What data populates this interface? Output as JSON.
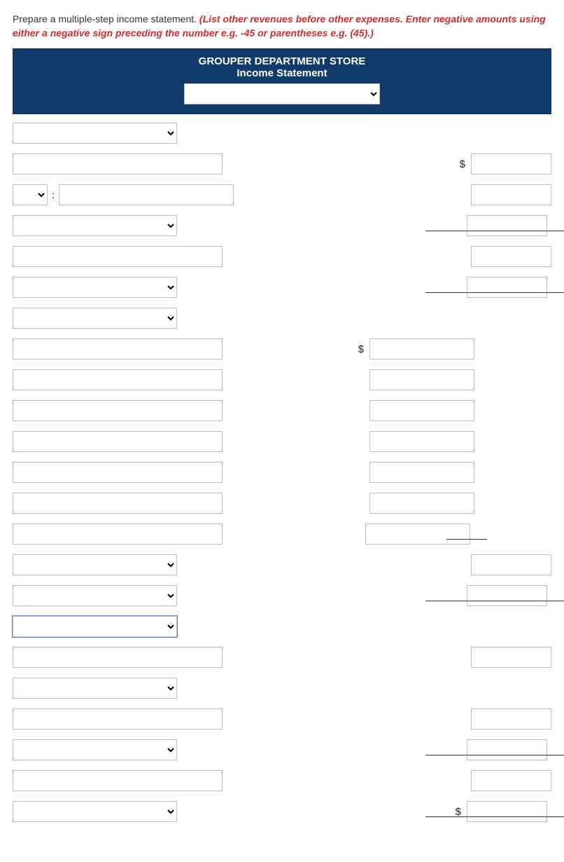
{
  "instructions": {
    "lead": "Prepare a multiple-step income statement. ",
    "em": "(List other revenues before other expenses. Enter negative amounts using either a negative sign preceding the number e.g. -45 or parentheses e.g. (45).)"
  },
  "header": {
    "company": "GROUPER DEPARTMENT STORE",
    "statement": "Income Statement",
    "period_select": ""
  },
  "rows": [
    {
      "left_type": "select-sm",
      "left_val": "",
      "sub": null,
      "amt": null
    },
    {
      "left_type": "input-md",
      "left_val": "",
      "sub": null,
      "amt": "",
      "amt_dollar": true
    },
    {
      "left_type": "tiny-label",
      "tiny_val": "",
      "label_sep": ":",
      "label_val": "",
      "sub": null,
      "amt": ""
    },
    {
      "left_type": "select-sm",
      "left_val": "",
      "sub": null,
      "amt": "",
      "underline_c3": true
    },
    {
      "left_type": "input-md",
      "left_val": "",
      "sub": null,
      "amt": ""
    },
    {
      "left_type": "select-sm",
      "left_val": "",
      "sub": null,
      "amt": "",
      "underline_c3": true
    },
    {
      "left_type": "select-sm",
      "left_val": "",
      "sub": null,
      "amt": null
    },
    {
      "left_type": "input-md",
      "left_val": "",
      "sub": "",
      "sub_dollar": true,
      "amt": null
    },
    {
      "left_type": "input-md",
      "left_val": "",
      "sub": "",
      "amt": null
    },
    {
      "left_type": "input-md",
      "left_val": "",
      "sub": "",
      "amt": null
    },
    {
      "left_type": "input-md",
      "left_val": "",
      "sub": "",
      "amt": null
    },
    {
      "left_type": "input-md",
      "left_val": "",
      "sub": "",
      "amt": null
    },
    {
      "left_type": "input-md",
      "left_val": "",
      "sub": "",
      "amt": null
    },
    {
      "left_type": "input-md",
      "left_val": "",
      "sub": "",
      "amt": null,
      "underline_c2": true
    },
    {
      "left_type": "select-sm",
      "left_val": "",
      "sub": null,
      "amt": ""
    },
    {
      "left_type": "select-sm",
      "left_val": "",
      "sub": null,
      "amt": "",
      "underline_c3": true
    },
    {
      "left_type": "select-sm",
      "left_val": "",
      "sub": null,
      "amt": null,
      "focused": true
    },
    {
      "left_type": "input-md",
      "left_val": "",
      "sub": null,
      "amt": ""
    },
    {
      "left_type": "select-sm",
      "left_val": "",
      "sub": null,
      "amt": null
    },
    {
      "left_type": "input-md",
      "left_val": "",
      "sub": null,
      "amt": ""
    },
    {
      "left_type": "select-sm",
      "left_val": "",
      "sub": null,
      "amt": "",
      "underline_c3": true
    },
    {
      "left_type": "input-md",
      "left_val": "",
      "sub": null,
      "amt": ""
    },
    {
      "left_type": "select-sm",
      "left_val": "",
      "sub": null,
      "amt": "",
      "amt_dollar": true,
      "underline_c3": true
    }
  ]
}
